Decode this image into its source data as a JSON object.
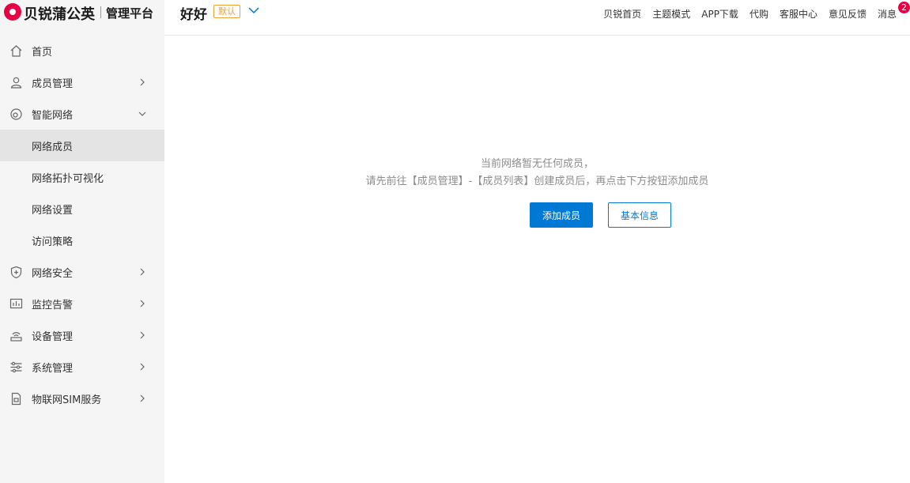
{
  "brand": {
    "name": "贝锐蒲公英",
    "subtitle": "管理平台"
  },
  "header": {
    "network_name": "好好",
    "default_badge": "默认",
    "links": [
      "贝锐首页",
      "主题模式",
      "APP下载",
      "代购",
      "客服中心",
      "意见反馈",
      "消息"
    ],
    "message_count": "2"
  },
  "sidebar": {
    "items": [
      {
        "label": "首页",
        "icon": "home-icon",
        "arrow": ""
      },
      {
        "label": "成员管理",
        "icon": "user-icon",
        "arrow": "right"
      },
      {
        "label": "智能网络",
        "icon": "network-icon",
        "arrow": "down"
      },
      {
        "label": "网络成员",
        "icon": "",
        "arrow": "",
        "active": true
      },
      {
        "label": "网络拓扑可视化",
        "icon": "",
        "arrow": ""
      },
      {
        "label": "网络设置",
        "icon": "",
        "arrow": ""
      },
      {
        "label": "访问策略",
        "icon": "",
        "arrow": ""
      },
      {
        "label": "网络安全",
        "icon": "shield-icon",
        "arrow": "right"
      },
      {
        "label": "监控告警",
        "icon": "monitor-icon",
        "arrow": "right"
      },
      {
        "label": "设备管理",
        "icon": "router-icon",
        "arrow": "right"
      },
      {
        "label": "系统管理",
        "icon": "settings-sliders-icon",
        "arrow": "right"
      },
      {
        "label": "物联网SIM服务",
        "icon": "sim-card-icon",
        "arrow": "right"
      }
    ]
  },
  "main": {
    "empty_line1": "当前网络暂无任何成员，",
    "empty_line2": "请先前往【成员管理】-【成员列表】创建成员后，再点击下方按钮添加成员",
    "add_member_button": "添加成员",
    "basic_info_button": "基本信息"
  },
  "colors": {
    "accent": "#0078d4",
    "brand": "#e60044",
    "badge": "#e8a23a"
  }
}
